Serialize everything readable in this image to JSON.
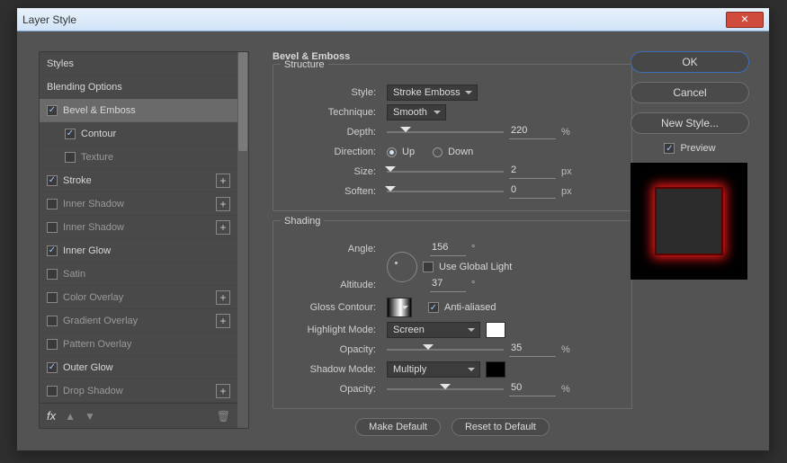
{
  "window": {
    "title": "Layer Style"
  },
  "buttons": {
    "ok": "OK",
    "cancel": "Cancel",
    "new_style": "New Style...",
    "make_default": "Make Default",
    "reset_default": "Reset to Default"
  },
  "preview": {
    "label": "Preview",
    "checked": true
  },
  "sidebar": {
    "header": "Styles",
    "items": [
      {
        "label": "Blending Options",
        "checked": null,
        "indent": false,
        "plus": false,
        "selected": false
      },
      {
        "label": "Bevel & Emboss",
        "checked": true,
        "indent": false,
        "plus": false,
        "selected": true
      },
      {
        "label": "Contour",
        "checked": true,
        "indent": true,
        "plus": false,
        "selected": false
      },
      {
        "label": "Texture",
        "checked": false,
        "indent": true,
        "plus": false,
        "selected": false
      },
      {
        "label": "Stroke",
        "checked": true,
        "indent": false,
        "plus": true,
        "selected": false
      },
      {
        "label": "Inner Shadow",
        "checked": false,
        "indent": false,
        "plus": true,
        "selected": false
      },
      {
        "label": "Inner Shadow",
        "checked": false,
        "indent": false,
        "plus": true,
        "selected": false
      },
      {
        "label": "Inner Glow",
        "checked": true,
        "indent": false,
        "plus": false,
        "selected": false
      },
      {
        "label": "Satin",
        "checked": false,
        "indent": false,
        "plus": false,
        "selected": false
      },
      {
        "label": "Color Overlay",
        "checked": false,
        "indent": false,
        "plus": true,
        "selected": false
      },
      {
        "label": "Gradient Overlay",
        "checked": false,
        "indent": false,
        "plus": true,
        "selected": false
      },
      {
        "label": "Pattern Overlay",
        "checked": false,
        "indent": false,
        "plus": false,
        "selected": false
      },
      {
        "label": "Outer Glow",
        "checked": true,
        "indent": false,
        "plus": false,
        "selected": false
      },
      {
        "label": "Drop Shadow",
        "checked": false,
        "indent": false,
        "plus": true,
        "selected": false
      }
    ],
    "footer_fx": "fx"
  },
  "bevel": {
    "group_title": "Bevel & Emboss",
    "structure_legend": "Structure",
    "shading_legend": "Shading",
    "labels": {
      "style": "Style:",
      "technique": "Technique:",
      "depth": "Depth:",
      "direction": "Direction:",
      "up": "Up",
      "down": "Down",
      "size": "Size:",
      "soften": "Soften:",
      "angle": "Angle:",
      "use_global": "Use Global Light",
      "altitude": "Altitude:",
      "gloss": "Gloss Contour:",
      "antialiased": "Anti-aliased",
      "highlight_mode": "Highlight Mode:",
      "opacity": "Opacity:",
      "shadow_mode": "Shadow Mode:"
    },
    "values": {
      "style": "Stroke Emboss",
      "technique": "Smooth",
      "depth": "220",
      "depth_unit": "%",
      "direction_up": true,
      "direction_down": false,
      "size": "2",
      "size_unit": "px",
      "soften": "0",
      "soften_unit": "px",
      "angle": "156",
      "angle_unit": "°",
      "use_global": false,
      "altitude": "37",
      "altitude_unit": "°",
      "antialiased": true,
      "highlight_mode": "Screen",
      "highlight_color": "#ffffff",
      "highlight_opacity": "35",
      "highlight_unit": "%",
      "shadow_mode": "Multiply",
      "shadow_color": "#000000",
      "shadow_opacity": "50",
      "shadow_unit": "%"
    },
    "slider_pos": {
      "depth": 16,
      "size": 3,
      "soften": 3,
      "hi_opacity": 35,
      "sh_opacity": 50
    }
  }
}
